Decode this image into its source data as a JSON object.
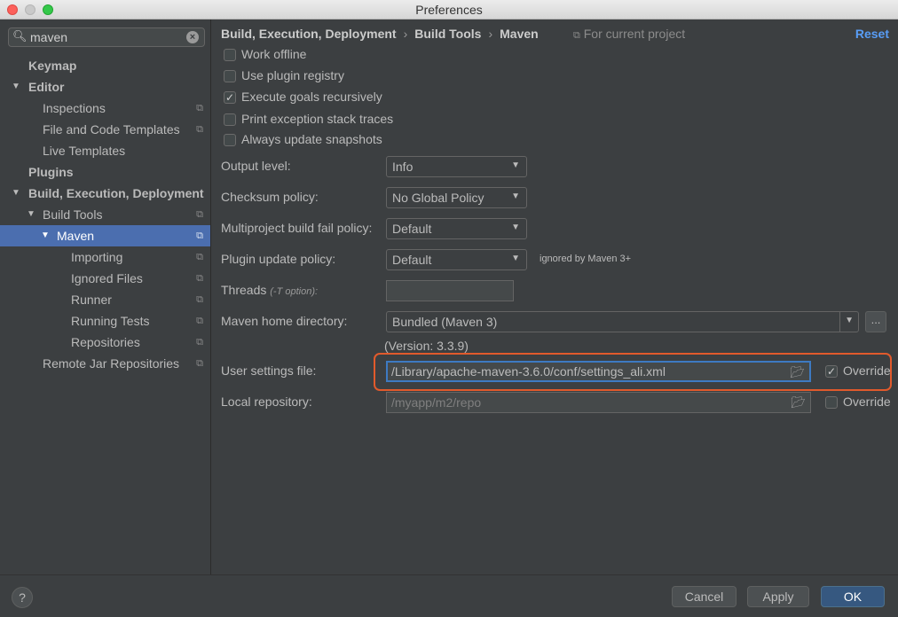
{
  "window": {
    "title": "Preferences"
  },
  "sidebar": {
    "search": {
      "value": "maven",
      "icon": "search-icon"
    },
    "items": [
      {
        "label": "Keymap"
      },
      {
        "label": "Editor"
      },
      {
        "label": "Inspections"
      },
      {
        "label": "File and Code Templates"
      },
      {
        "label": "Live Templates"
      },
      {
        "label": "Plugins"
      },
      {
        "label": "Build, Execution, Deployment"
      },
      {
        "label": "Build Tools"
      },
      {
        "label": "Maven"
      },
      {
        "label": "Importing"
      },
      {
        "label": "Ignored Files"
      },
      {
        "label": "Runner"
      },
      {
        "label": "Running Tests"
      },
      {
        "label": "Repositories"
      },
      {
        "label": "Remote Jar Repositories"
      }
    ]
  },
  "header": {
    "breadcrumb": [
      "Build, Execution, Deployment",
      "Build Tools",
      "Maven"
    ],
    "scope": "For current project",
    "reset": "Reset"
  },
  "options": [
    {
      "label": "Work offline",
      "checked": false
    },
    {
      "label": "Use plugin registry",
      "checked": false
    },
    {
      "label": "Execute goals recursively",
      "checked": true
    },
    {
      "label": "Print exception stack traces",
      "checked": false
    },
    {
      "label": "Always update snapshots",
      "checked": false
    }
  ],
  "fields": {
    "output_level": {
      "label": "Output level:",
      "value": "Info"
    },
    "checksum_policy": {
      "label": "Checksum policy:",
      "value": "No Global Policy"
    },
    "multiproject_policy": {
      "label": "Multiproject build fail policy:",
      "value": "Default"
    },
    "plugin_update_policy": {
      "label": "Plugin update policy:",
      "value": "Default",
      "note": "ignored by Maven 3+"
    },
    "threads": {
      "label": "Threads",
      "hint": "(-T option):",
      "value": ""
    },
    "maven_home": {
      "label": "Maven home directory:",
      "value": "Bundled (Maven 3)",
      "button": "...",
      "version": "(Version: 3.3.9)"
    },
    "user_settings": {
      "label": "User settings file:",
      "value": "/Library/apache-maven-3.6.0/conf/settings_ali.xml",
      "override_label": "Override",
      "override": true
    },
    "local_repo": {
      "label": "Local repository:",
      "value": "/myapp/m2/repo",
      "override_label": "Override",
      "override": false
    }
  },
  "footer": {
    "help": "?",
    "cancel": "Cancel",
    "apply": "Apply",
    "ok": "OK"
  },
  "colors": {
    "accent": "#4b6eaf",
    "link": "#589df6",
    "highlight": "#e15a2c",
    "focus": "#3d7ac2"
  }
}
